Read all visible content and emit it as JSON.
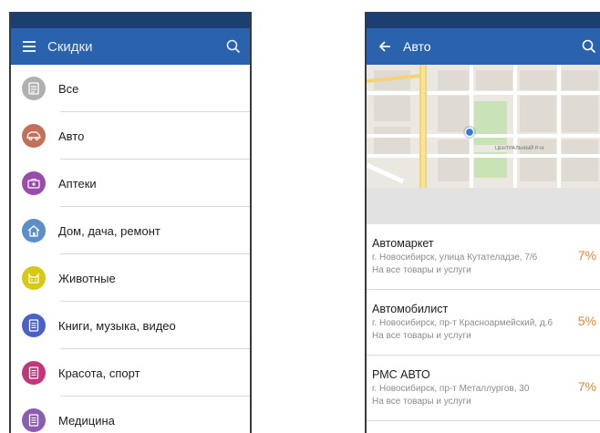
{
  "left_screen": {
    "header": {
      "title": "Скидки",
      "menu_icon": "menu-icon",
      "search_icon": "search-icon"
    },
    "categories": [
      {
        "label": "Все",
        "color": "#b0b0b0",
        "icon": "document-icon"
      },
      {
        "label": "Авто",
        "color": "#c2705a",
        "icon": "car-icon"
      },
      {
        "label": "Аптеки",
        "color": "#9a4bab",
        "icon": "first-aid-icon"
      },
      {
        "label": "Дом, дача, ремонт",
        "color": "#5c8ec8",
        "icon": "house-icon"
      },
      {
        "label": "Животные",
        "color": "#d7c816",
        "icon": "animal-icon"
      },
      {
        "label": "Книги, музыка, видео",
        "color": "#4a61c8",
        "icon": "book-icon"
      },
      {
        "label": "Красота, спорт",
        "color": "#c0387a",
        "icon": "beauty-icon"
      },
      {
        "label": "Медицина",
        "color": "#8c5cb0",
        "icon": "medical-icon"
      }
    ]
  },
  "right_screen": {
    "header": {
      "title": "Авто",
      "back_icon": "arrow-left-icon",
      "search_icon": "search-icon"
    },
    "map": {
      "district_label": "ЦЕНТРАЛЬНЫЙ Р-Н",
      "marker_color": "#3a78d8"
    },
    "shops": [
      {
        "name": "Автомаркет",
        "address": "г. Новосибирск, улица Кутателадзе, 7/6",
        "terms": "На все товары и услуги",
        "discount": "7%"
      },
      {
        "name": "Автомобилист",
        "address": "г. Новосибирск, пр-т Красноармейский, д.6",
        "terms": "На все товары и услуги",
        "discount": "5%"
      },
      {
        "name": "РМС АВТО",
        "address": "г. Новосибирск, пр-т Металлургов, 30",
        "terms": "На все товары и услуги",
        "discount": "7%"
      }
    ]
  },
  "colors": {
    "status_bar": "#1c3e70",
    "app_bar": "#2a62ad",
    "discount": "#e08a2a"
  }
}
